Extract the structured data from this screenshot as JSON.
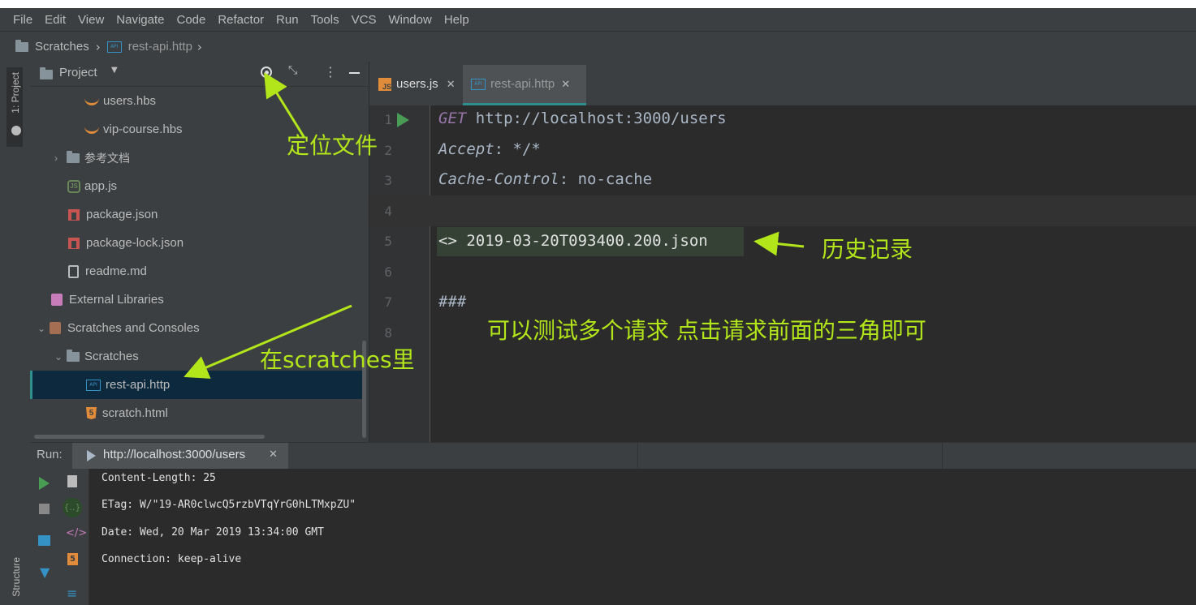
{
  "menu": [
    "File",
    "Edit",
    "View",
    "Navigate",
    "Code",
    "Refactor",
    "Run",
    "Tools",
    "VCS",
    "Window",
    "Help"
  ],
  "breadcrumb": {
    "root": "Scratches",
    "file": "rest-api.http"
  },
  "left_strip": {
    "project_label": "1: Project",
    "structure_label": "Structure"
  },
  "project_panel": {
    "title": "Project",
    "items": [
      {
        "label": "users.hbs",
        "icon": "handlebars-icon"
      },
      {
        "label": "vip-course.hbs",
        "icon": "handlebars-icon"
      },
      {
        "label": "参考文档",
        "icon": "folder-icon"
      },
      {
        "label": "app.js",
        "icon": "nodejs-icon"
      },
      {
        "label": "package.json",
        "icon": "npm-icon"
      },
      {
        "label": "package-lock.json",
        "icon": "npm-icon"
      },
      {
        "label": "readme.md",
        "icon": "markdown-icon"
      },
      {
        "label": "External Libraries",
        "icon": "library-icon"
      },
      {
        "label": "Scratches and Consoles",
        "icon": "scratches-icon"
      },
      {
        "label": "Scratches",
        "icon": "folder-icon"
      },
      {
        "label": "rest-api.http",
        "icon": "http-file-icon"
      },
      {
        "label": "scratch.html",
        "icon": "html5-icon"
      }
    ]
  },
  "tabs": [
    {
      "label": "users.js",
      "active": false
    },
    {
      "label": "rest-api.http",
      "active": true
    }
  ],
  "editor": {
    "line_numbers": [
      "1",
      "2",
      "3",
      "4",
      "5",
      "6",
      "7",
      "8"
    ],
    "method": "GET",
    "url": " http://localhost:3000/users",
    "h1_name": "Accept",
    "h1_value": ": */*",
    "h2_name": "Cache-Control",
    "h2_value": ": no-cache",
    "history": "<> 2019-03-20T093400.200.json",
    "separator": "###"
  },
  "annotations": {
    "locate": "定位文件",
    "history": "历史记录",
    "multi": "可以测试多个请求  点击请求前面的三角即可",
    "scratches": "在scratches里"
  },
  "run": {
    "label": "Run:",
    "tab": "http://localhost:3000/users",
    "output": [
      "Content-Length: 25",
      "ETag: W/\"19-AR0clwcQ5rzbVTqYrG0hLTMxpZU\"",
      "Date: Wed, 20 Mar 2019 13:34:00 GMT",
      "Connection: keep-alive"
    ]
  },
  "colors": {
    "annotation": "#b3e61a",
    "run_green": "#499c54",
    "method": "#9876aa"
  }
}
